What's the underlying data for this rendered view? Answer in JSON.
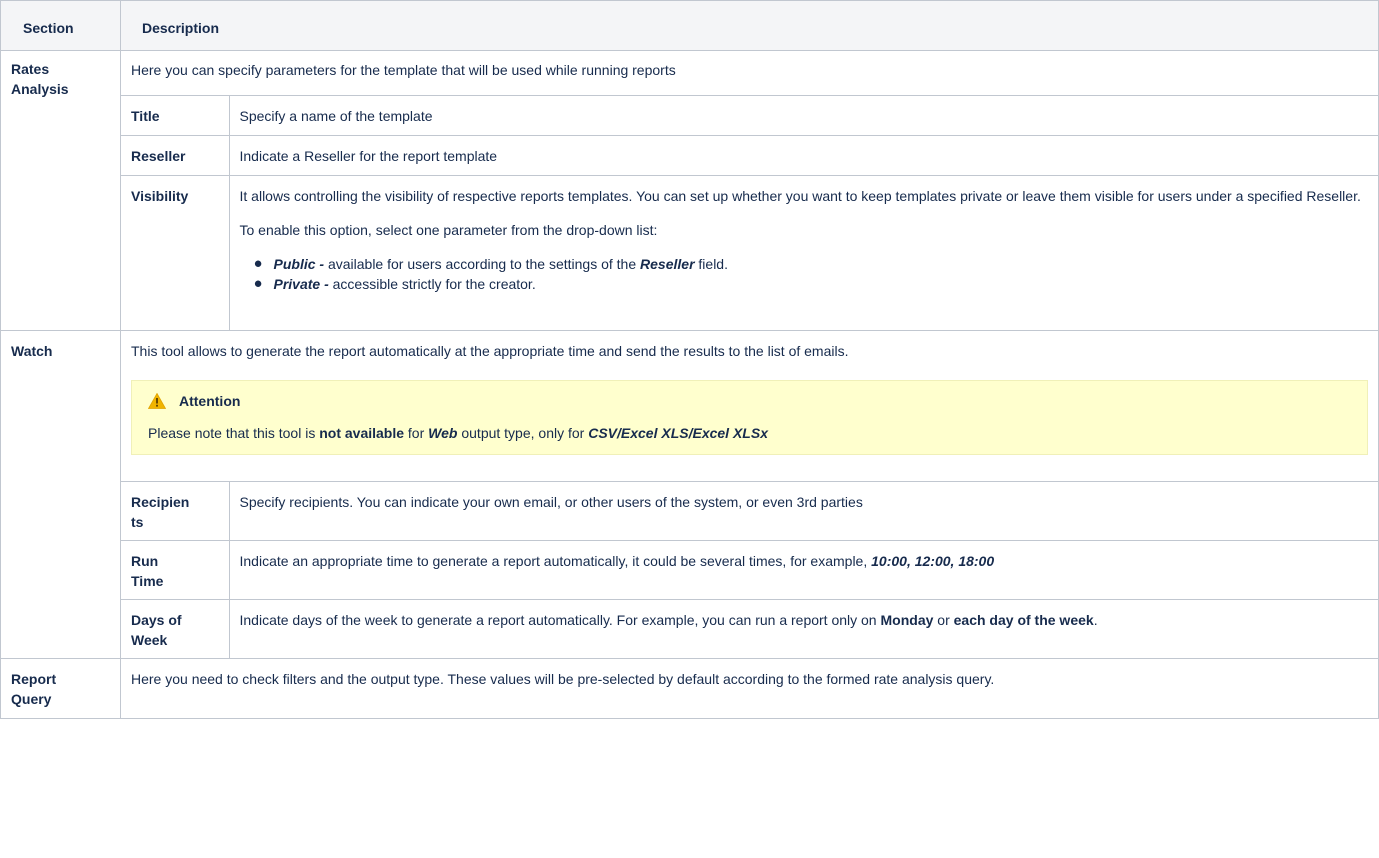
{
  "header": {
    "section": "Section",
    "description": "Description"
  },
  "rates": {
    "section_line1": "Rates",
    "section_line2": "Analysis",
    "intro": "Here you can specify parameters for the template that will be used while running reports",
    "title_label": "Title",
    "title_desc": "Specify a name of the template",
    "reseller_label": "Reseller",
    "reseller_desc": "Indicate a Reseller for the report template",
    "visibility_label": "Visibility",
    "visibility_p1": "It allows controlling the visibility of respective reports templates. You can set up whether you want to keep templates private or leave them visible for users under a specified Reseller.",
    "visibility_p2": "To enable this option, select one parameter from the drop-down list:",
    "public_term": "Public -",
    "public_desc": " available for users according to the settings of the ",
    "public_field": "Reseller",
    "public_tail": " field.",
    "private_term": "Private -",
    "private_desc": " accessible strictly for the creator."
  },
  "watch": {
    "section": "Watch",
    "intro": "This tool allows to generate the report automatically at the appropriate time and send the results to the list of emails.",
    "attention_title": "Attention",
    "attention_pre": "Please note that this tool is ",
    "attention_bold": "not available",
    "attention_mid": " for ",
    "attention_web": "Web",
    "attention_mid2": " output type, only for ",
    "attention_formats": "CSV/Excel XLS/Excel XLSx",
    "recipients_label_1": "Recipien",
    "recipients_label_2": "ts",
    "recipients_desc": "Specify recipients. You can indicate your own email, or other users of the system, or even 3rd parties",
    "runtime_label_1": "Run",
    "runtime_label_2": "Time",
    "runtime_desc": "Indicate an appropriate time to generate a report automatically, it could be several times, for example, ",
    "runtime_example": "10:00, 12:00, 18:00",
    "days_label_1": "Days of",
    "days_label_2": "Week",
    "days_desc": "Indicate days of the week to generate a report automatically. For example, you can run a report only on ",
    "days_monday": "Monday",
    "days_or": " or ",
    "days_each": "each day of the week",
    "days_end": "."
  },
  "query": {
    "section_line1": "Report",
    "section_line2": "Query",
    "desc": "Here you need to check filters and the output type. These values will be pre-selected by default according to the formed rate analysis query."
  },
  "colors": {
    "header_bg": "#f4f5f7",
    "border": "#c1c7d0",
    "warning_bg": "#ffffce",
    "warning_icon": "#f0b400"
  }
}
